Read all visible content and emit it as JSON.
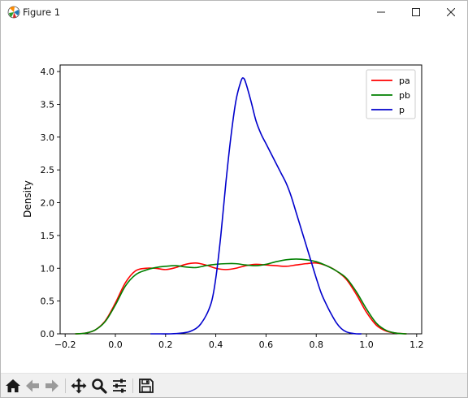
{
  "window": {
    "title": "Figure 1",
    "controls": [
      "minimize",
      "maximize",
      "close"
    ]
  },
  "toolbar": {
    "buttons": [
      {
        "name": "home-icon",
        "tooltip": "Reset original view"
      },
      {
        "name": "back-icon",
        "tooltip": "Back to previous view"
      },
      {
        "name": "forward-icon",
        "tooltip": "Forward to next view"
      },
      {
        "name": "pan-icon",
        "tooltip": "Pan axes"
      },
      {
        "name": "zoom-icon",
        "tooltip": "Zoom to rectangle"
      },
      {
        "name": "configure-subplots-icon",
        "tooltip": "Configure subplots"
      },
      {
        "name": "save-icon",
        "tooltip": "Save the figure"
      }
    ]
  },
  "chart_data": {
    "type": "line",
    "title": "",
    "xlabel": "",
    "ylabel": "Density",
    "xlim": [
      -0.22,
      1.22
    ],
    "ylim": [
      0.0,
      4.1
    ],
    "xticks": [
      "−0.2",
      "0.0",
      "0.2",
      "0.4",
      "0.6",
      "0.8",
      "1.0",
      "1.2"
    ],
    "xtick_values": [
      -0.2,
      0.0,
      0.2,
      0.4,
      0.6,
      0.8,
      1.0,
      1.2
    ],
    "yticks": [
      "0.0",
      "0.5",
      "1.0",
      "1.5",
      "2.0",
      "2.5",
      "3.0",
      "3.5",
      "4.0"
    ],
    "ytick_values": [
      0.0,
      0.5,
      1.0,
      1.5,
      2.0,
      2.5,
      3.0,
      3.5,
      4.0
    ],
    "grid": false,
    "legend_position": "top-right",
    "series": [
      {
        "name": "pa",
        "color": "#ff0000",
        "x": [
          -0.16,
          -0.12,
          -0.08,
          -0.04,
          0.0,
          0.04,
          0.08,
          0.12,
          0.16,
          0.2,
          0.24,
          0.28,
          0.32,
          0.36,
          0.4,
          0.44,
          0.48,
          0.52,
          0.56,
          0.6,
          0.64,
          0.68,
          0.72,
          0.76,
          0.8,
          0.84,
          0.88,
          0.92,
          0.96,
          1.0,
          1.04,
          1.08,
          1.12,
          1.16
        ],
        "y": [
          0.0,
          0.01,
          0.06,
          0.2,
          0.47,
          0.78,
          0.96,
          1.0,
          1.0,
          0.98,
          1.01,
          1.06,
          1.08,
          1.05,
          1.0,
          0.98,
          1.0,
          1.04,
          1.06,
          1.05,
          1.04,
          1.03,
          1.05,
          1.07,
          1.08,
          1.04,
          0.96,
          0.83,
          0.6,
          0.33,
          0.13,
          0.04,
          0.01,
          0.0
        ]
      },
      {
        "name": "pb",
        "color": "#008000",
        "x": [
          -0.16,
          -0.12,
          -0.08,
          -0.04,
          0.0,
          0.04,
          0.08,
          0.12,
          0.16,
          0.2,
          0.24,
          0.28,
          0.32,
          0.36,
          0.4,
          0.44,
          0.48,
          0.52,
          0.56,
          0.6,
          0.64,
          0.68,
          0.72,
          0.76,
          0.8,
          0.84,
          0.88,
          0.92,
          0.96,
          1.0,
          1.04,
          1.08,
          1.12,
          1.16
        ],
        "y": [
          0.0,
          0.01,
          0.06,
          0.19,
          0.44,
          0.73,
          0.9,
          0.97,
          1.01,
          1.03,
          1.04,
          1.02,
          1.01,
          1.04,
          1.06,
          1.07,
          1.07,
          1.05,
          1.04,
          1.06,
          1.1,
          1.13,
          1.14,
          1.13,
          1.1,
          1.04,
          0.96,
          0.85,
          0.64,
          0.38,
          0.16,
          0.05,
          0.01,
          0.0
        ]
      },
      {
        "name": "p",
        "color": "#0000cc",
        "x": [
          0.14,
          0.18,
          0.22,
          0.26,
          0.3,
          0.34,
          0.38,
          0.4,
          0.42,
          0.44,
          0.46,
          0.48,
          0.5,
          0.51,
          0.52,
          0.54,
          0.56,
          0.58,
          0.6,
          0.62,
          0.64,
          0.66,
          0.68,
          0.7,
          0.72,
          0.74,
          0.76,
          0.78,
          0.8,
          0.82,
          0.84,
          0.86,
          0.88,
          0.9,
          0.92,
          0.94,
          0.96,
          0.98
        ],
        "y": [
          0.0,
          0.0,
          0.0,
          0.01,
          0.04,
          0.15,
          0.45,
          0.85,
          1.5,
          2.3,
          3.0,
          3.55,
          3.85,
          3.9,
          3.82,
          3.55,
          3.25,
          3.05,
          2.9,
          2.75,
          2.6,
          2.45,
          2.3,
          2.1,
          1.85,
          1.6,
          1.35,
          1.1,
          0.85,
          0.62,
          0.45,
          0.3,
          0.17,
          0.08,
          0.03,
          0.01,
          0.0,
          0.0
        ]
      }
    ]
  }
}
